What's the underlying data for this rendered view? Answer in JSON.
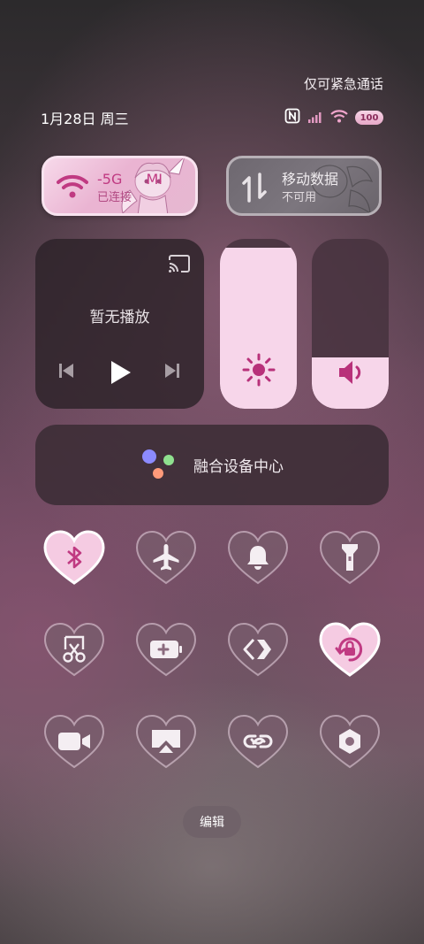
{
  "emergency_text": "仅可紧急通话",
  "status": {
    "date": "1月28日 周三",
    "battery": "100"
  },
  "wifi": {
    "ssid_fragment": "-5G",
    "ssid_extra": "MI",
    "status": "已连接"
  },
  "mobile_data": {
    "title": "移动数据",
    "status": "不可用"
  },
  "media": {
    "title": "暂无播放"
  },
  "sliders": {
    "brightness_level": 0.95,
    "volume_level": 0.3
  },
  "device_center": {
    "label": "融合设备中心"
  },
  "toggles": [
    {
      "name": "bluetooth",
      "active": true
    },
    {
      "name": "airplane-mode",
      "active": false
    },
    {
      "name": "ring-mode",
      "active": false
    },
    {
      "name": "flashlight",
      "active": false
    },
    {
      "name": "screenshot",
      "active": false
    },
    {
      "name": "battery-saver",
      "active": false
    },
    {
      "name": "nfc-share",
      "active": false
    },
    {
      "name": "rotation-lock",
      "active": true
    },
    {
      "name": "screen-record",
      "active": false
    },
    {
      "name": "screen-cast",
      "active": false
    },
    {
      "name": "link",
      "active": false
    },
    {
      "name": "settings",
      "active": false
    }
  ],
  "edit_label": "编辑",
  "colors": {
    "accent": "#c03a82",
    "active_heart": "#f5cbe2"
  }
}
